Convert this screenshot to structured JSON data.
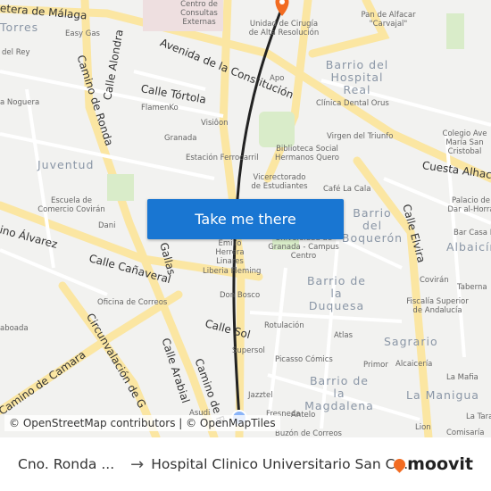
{
  "map": {
    "cta_label": "Take me there",
    "attribution": "© OpenStreetMap contributors | © OpenMapTiles",
    "route_color": "#222222",
    "destination_color": "#f26b21",
    "origin_color": "#8ab4f8",
    "roads": [
      "etera de Málaga",
      "Avenida de la Constitución",
      "Calle Tórtola",
      "Calle Alondra",
      "Camino de Ronda",
      "Calle Cañaveral",
      "Camino de Camara",
      "Circunvalación de G",
      "Calle Arabial",
      "Calle Sol",
      "Cuesta Alhaca",
      "Calle Elvira",
      "ino Álvarez",
      "Gallas",
      "Camino de R"
    ],
    "neighborhoods": [
      "Torres",
      "Juventud",
      "Barrio del Hospital Real",
      "Barrio del Boquerón",
      "Barrio de la Duquesa",
      "Sagrario",
      "Barrio de la Magdalena",
      "La Manigua",
      "Albaicín"
    ],
    "pois": [
      "Centro de Consultas Externas",
      "Easy Gas",
      "del Rey",
      "Unidad de Cirugía de Alta Resolución",
      "Pan de Alfacar \"Carvajal\"",
      "Apo",
      "Clínica Dental Orus",
      "FlamenKo",
      "Visiôon",
      "Granada",
      "Estación Ferrocarril",
      "Biblioteca Social Hermanos Quero",
      "Virgen del Triunfo",
      "Vicerectorado de Estudiantes",
      "Café La Cala",
      "Colegio Ave María San Cristobal",
      "Escuela de Comercio Covirán",
      "Dani",
      "Emilio Herrera Linares",
      "Liberia Fleming",
      "Universidad de Granada - Campus Centro",
      "Don Bosco",
      "Oficina de Correos",
      "Rotulación",
      "Supersol",
      "Atlas",
      "Covirán",
      "Fiscalía Superior de Andalucía",
      "Picasso Cómics",
      "Primor",
      "Alcaicería",
      "La Mafia",
      "Jazztel",
      "Fresneda",
      "Antelo",
      "Buzón de Correos",
      "Lion",
      "La Tarara",
      "Comisaría",
      "Bar Casa María",
      "Palacio de Dar al-Horra",
      "Taberna",
      "a Noguera",
      "aboada",
      "Asudi"
    ]
  },
  "footer": {
    "origin": "Cno. Ronda ...",
    "destination": "Hospital Clinico Universitario San C...",
    "brand": "moovit"
  }
}
